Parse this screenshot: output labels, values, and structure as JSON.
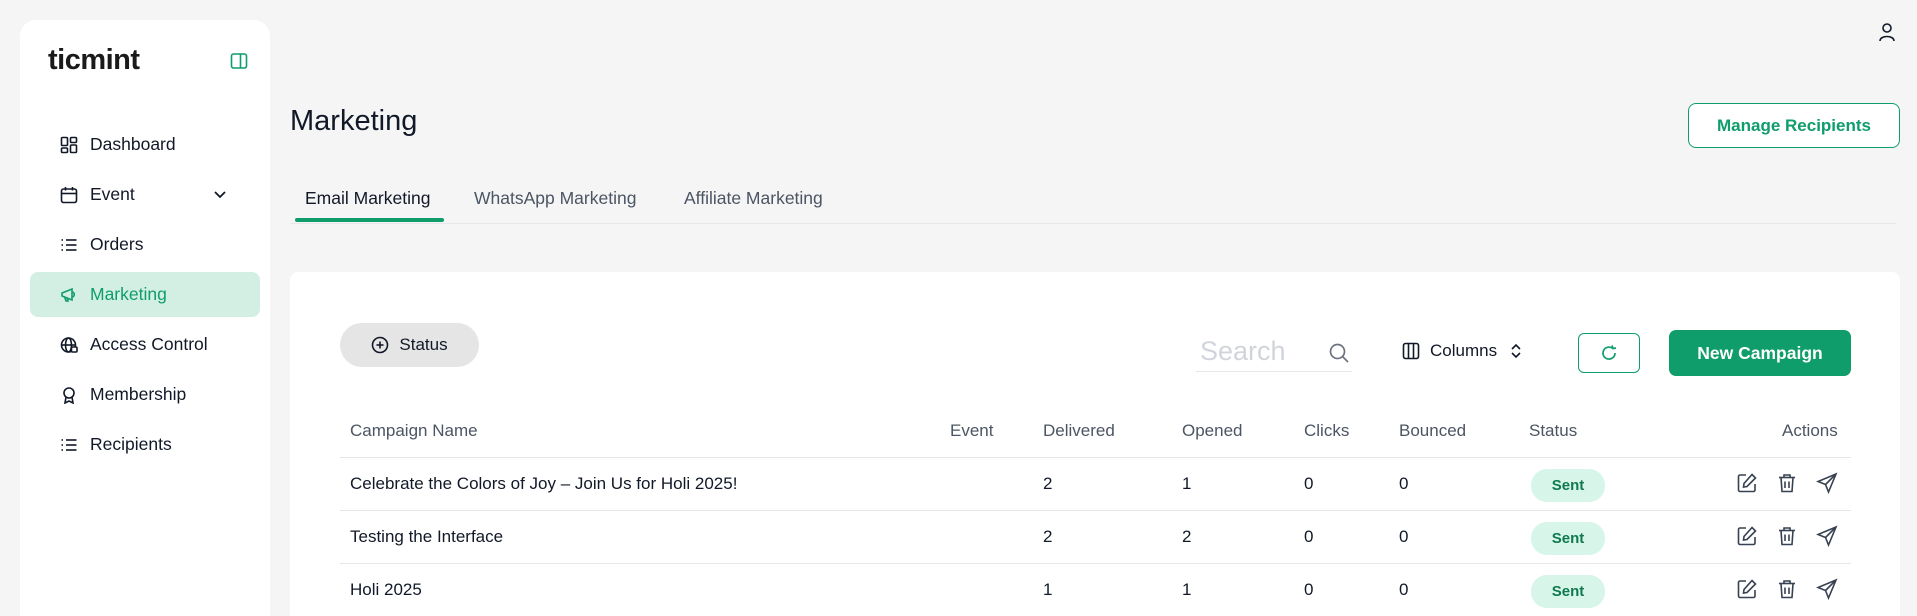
{
  "app": {
    "logo_text": "ticmint"
  },
  "sidebar": {
    "items": [
      {
        "label": "Dashboard",
        "icon": "dashboard-icon"
      },
      {
        "label": "Event",
        "icon": "calendar-icon",
        "expandable": true
      },
      {
        "label": "Orders",
        "icon": "list-icon"
      },
      {
        "label": "Marketing",
        "icon": "megaphone-icon",
        "active": true
      },
      {
        "label": "Access Control",
        "icon": "globe-lock-icon"
      },
      {
        "label": "Membership",
        "icon": "award-icon"
      },
      {
        "label": "Recipients",
        "icon": "list-icon"
      }
    ]
  },
  "header": {
    "title": "Marketing",
    "manage_label": "Manage Recipients"
  },
  "tabs": [
    {
      "label": "Email Marketing",
      "active": true
    },
    {
      "label": "WhatsApp Marketing"
    },
    {
      "label": "Affiliate Marketing"
    }
  ],
  "toolbar": {
    "status_label": "Status",
    "search_placeholder": "Search",
    "columns_label": "Columns",
    "new_campaign_label": "New Campaign"
  },
  "table": {
    "headers": {
      "name": "Campaign Name",
      "event": "Event",
      "delivered": "Delivered",
      "opened": "Opened",
      "clicks": "Clicks",
      "bounced": "Bounced",
      "status": "Status",
      "actions": "Actions"
    },
    "rows": [
      {
        "name": "Celebrate the Colors of Joy – Join Us for Holi 2025!",
        "event": "",
        "delivered": "2",
        "opened": "1",
        "clicks": "0",
        "bounced": "0",
        "status": "Sent"
      },
      {
        "name": "Testing the Interface",
        "event": "",
        "delivered": "2",
        "opened": "2",
        "clicks": "0",
        "bounced": "0",
        "status": "Sent"
      },
      {
        "name": "Holi 2025",
        "event": "",
        "delivered": "1",
        "opened": "1",
        "clicks": "0",
        "bounced": "0",
        "status": "Sent"
      }
    ]
  },
  "colors": {
    "accent": "#0f9d6b",
    "active_bg": "#d3efe3",
    "badge_bg": "#d7f5e8"
  }
}
